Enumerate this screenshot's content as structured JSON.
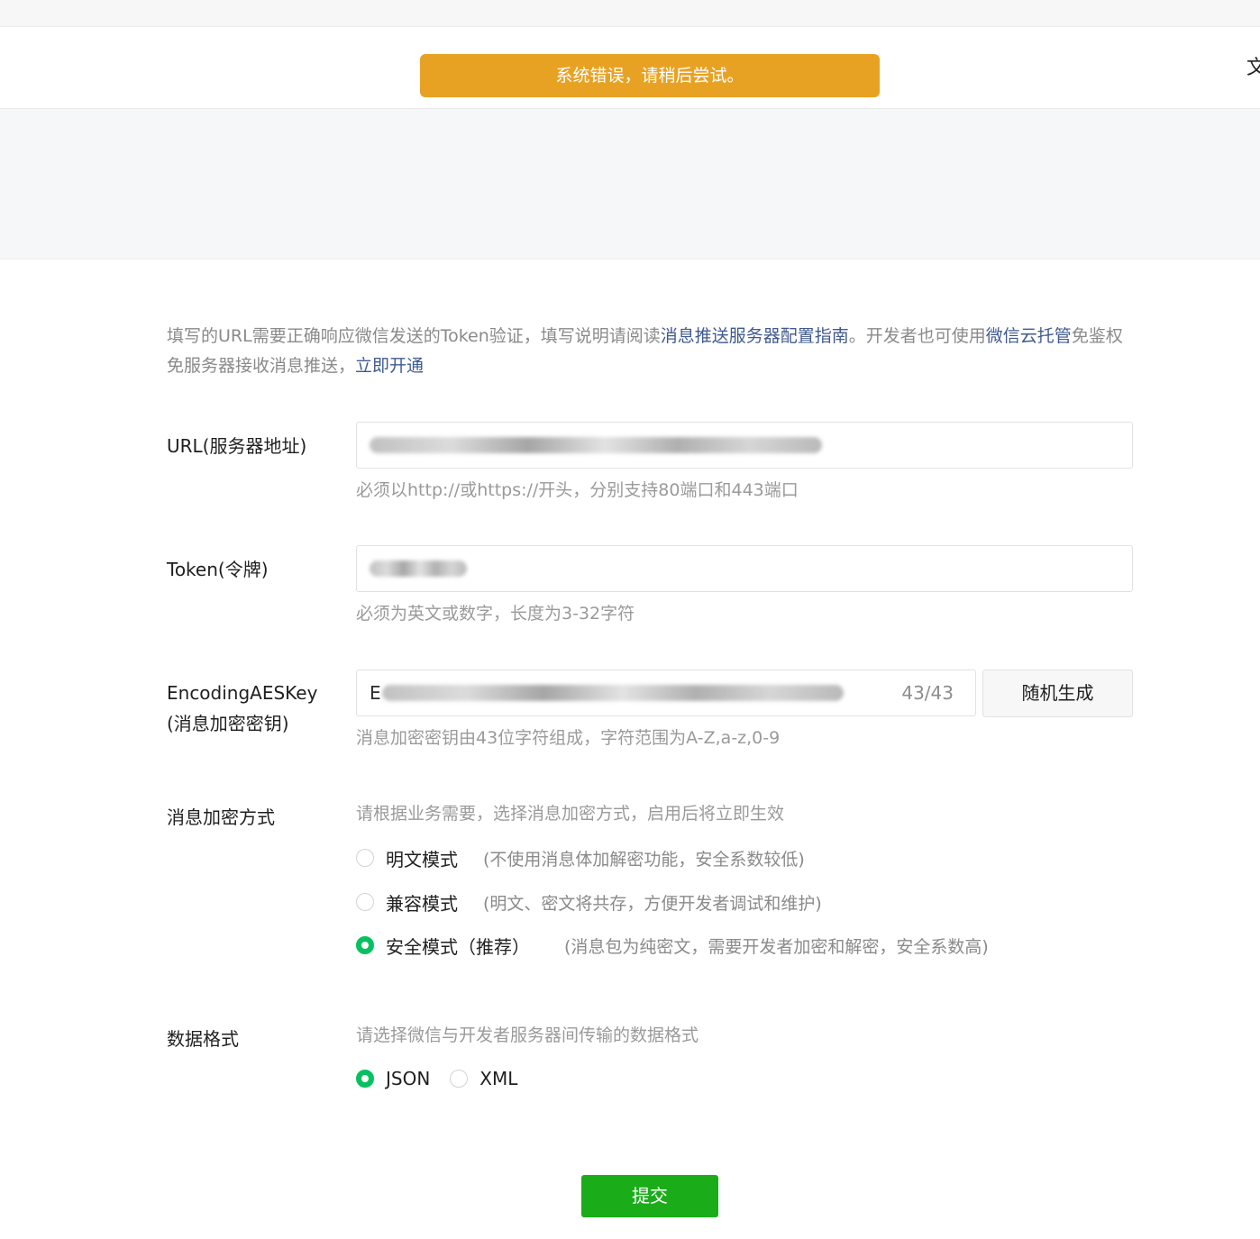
{
  "toast": {
    "message": "系统错误，请稍后尝试。"
  },
  "header": {
    "edge_text": "文"
  },
  "intro": {
    "part1": "填写的URL需要正确响应微信发送的Token验证，填写说明请阅读",
    "link1": "消息推送服务器配置指南",
    "part2": "。开发者也可使用",
    "link2": "微信云托管",
    "part3": "免鉴权免服务器接收消息推送，",
    "link3": "立即开通"
  },
  "url_field": {
    "label": "URL(服务器地址)",
    "hint": "必须以http://或https://开头，分别支持80端口和443端口"
  },
  "token_field": {
    "label": "Token(令牌)",
    "hint": "必须为英文或数字，长度为3-32字符"
  },
  "aes_field": {
    "label_line1": "EncodingAESKey",
    "label_line2": "(消息加密密钥)",
    "prefix": "E",
    "counter": "43/43",
    "generate_button": "随机生成",
    "hint": "消息加密密钥由43位字符组成，字符范围为A-Z,a-z,0-9"
  },
  "encryption": {
    "label": "消息加密方式",
    "hint": "请根据业务需要，选择消息加密方式，启用后将立即生效",
    "options": [
      {
        "label": "明文模式",
        "desc": "(不使用消息体加解密功能，安全系数较低)",
        "selected": false
      },
      {
        "label": "兼容模式",
        "desc": "(明文、密文将共存，方便开发者调试和维护)",
        "selected": false
      },
      {
        "label": "安全模式（推荐）",
        "desc": "(消息包为纯密文，需要开发者加密和解密，安全系数高)",
        "selected": true
      }
    ]
  },
  "data_format": {
    "label": "数据格式",
    "hint": "请选择微信与开发者服务器间传输的数据格式",
    "options": [
      {
        "label": "JSON",
        "selected": true
      },
      {
        "label": "XML",
        "selected": false
      }
    ]
  },
  "submit": {
    "label": "提交"
  },
  "colors": {
    "toast_bg": "#e8a223",
    "link": "#3f5a8f",
    "radio_checked": "#07c160",
    "submit_bg": "#1aad19"
  }
}
